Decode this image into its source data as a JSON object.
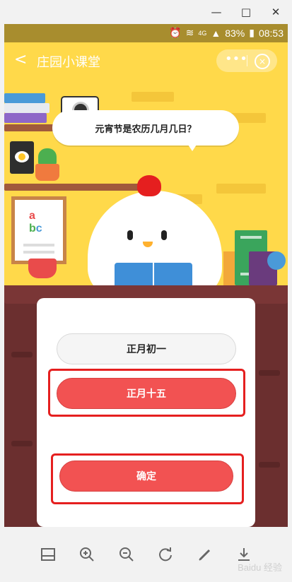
{
  "window": {
    "minimize_label": "—",
    "maximize_label": "□",
    "close_label": "✕"
  },
  "status_bar": {
    "network": "4G",
    "battery": "83%",
    "time": "08:53"
  },
  "header": {
    "back_label": "<",
    "title": "庄园小课堂",
    "menu_label": "•••",
    "close_label": "×"
  },
  "question": {
    "text": "元宵节是农历几月几日？"
  },
  "options": [
    {
      "label": "正月初一",
      "selected": false
    },
    {
      "label": "正月十五",
      "selected": true
    }
  ],
  "confirm_label": "确定",
  "toolbar": {
    "icons": [
      "crop-icon",
      "zoom-in-icon",
      "zoom-out-icon",
      "rotate-icon",
      "pen-icon",
      "download-icon"
    ]
  },
  "watermark": "Baidu 经验",
  "colors": {
    "accent_red": "#f25252",
    "highlight_red": "#e51f1f",
    "scene_yellow": "#ffd94a",
    "table_brown": "#6b2f2f"
  }
}
